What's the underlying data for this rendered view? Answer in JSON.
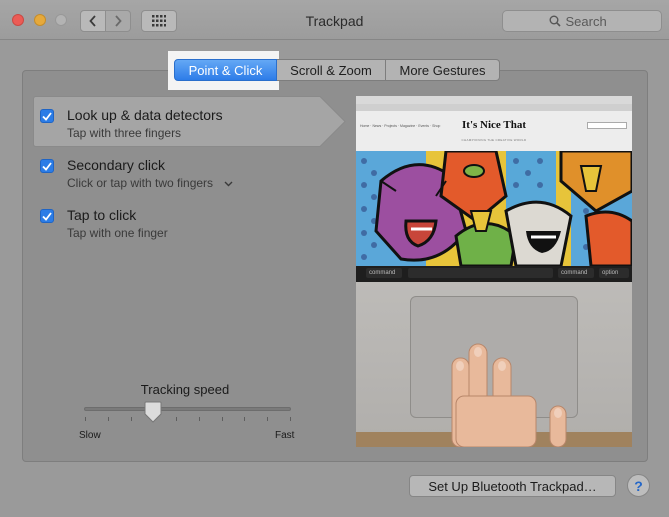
{
  "window": {
    "title": "Trackpad"
  },
  "search": {
    "placeholder": "Search"
  },
  "tabs": [
    {
      "label": "Point & Click",
      "active": true
    },
    {
      "label": "Scroll & Zoom",
      "active": false
    },
    {
      "label": "More Gestures",
      "active": false
    }
  ],
  "options": [
    {
      "title": "Look up & data detectors",
      "subtitle": "Tap with three fingers",
      "checked": true,
      "selected": true
    },
    {
      "title": "Secondary click",
      "subtitle": "Click or tap with two fingers",
      "checked": true,
      "has_dropdown": true
    },
    {
      "title": "Tap to click",
      "subtitle": "Tap with one finger",
      "checked": true
    }
  ],
  "tracking": {
    "label": "Tracking speed",
    "min_label": "Slow",
    "max_label": "Fast",
    "tick_count": 10,
    "value_index": 3
  },
  "preview": {
    "site_title": "It's Nice That",
    "nav_items": "Home · News · Projects · Magazine · Events · Shop",
    "tagline": "CHAMPIONING THE CREATIVE WORLD",
    "keys": {
      "left": "command",
      "right": "command",
      "option": "option"
    }
  },
  "bottom": {
    "setup_button": "Set Up Bluetooth Trackpad…",
    "help": "?"
  },
  "colors": {
    "accent": "#2b7ce6",
    "window_bg": "#9a9a9a",
    "panel_bg": "#8f8f8f"
  }
}
